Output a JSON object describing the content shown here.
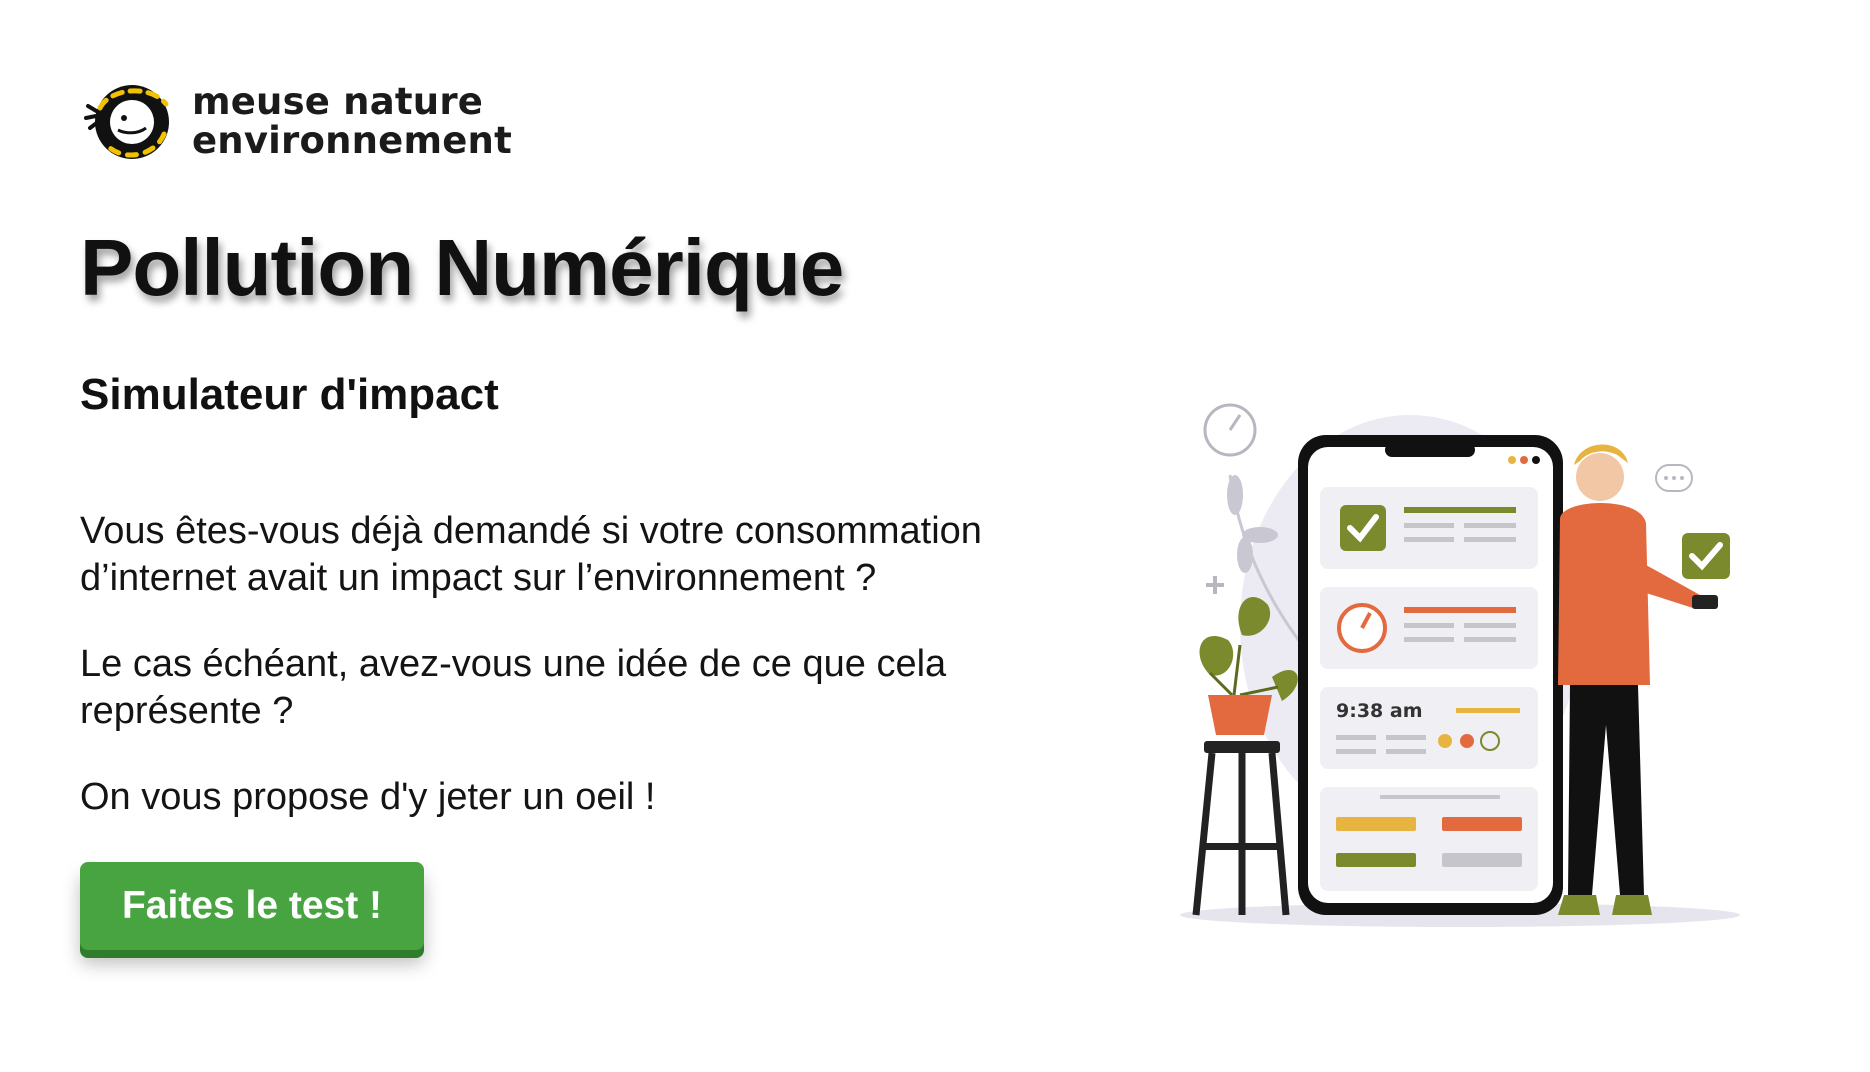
{
  "brand": {
    "line1": "meuse nature",
    "line2": "environnement",
    "logo_icon": "salamander-logo-icon"
  },
  "hero": {
    "title": "Pollution Numérique",
    "subtitle": "Simulateur d'impact",
    "paragraphs": [
      "Vous êtes-vous déjà demandé si votre consommation d’internet avait un impact sur l’environnement ?",
      "Le cas échéant, avez-vous une idée de ce que cela représente ?",
      "On vous propose d'y jeter un oeil !"
    ],
    "cta_label": "Faites le test !"
  },
  "illustration": {
    "phone_time": "9:38 am",
    "icons": [
      "phone-illustration",
      "person-illustration",
      "plant-illustration",
      "check-icon",
      "gauge-icon",
      "chat-bubble-icon"
    ]
  },
  "colors": {
    "cta": "#47a440",
    "accent_orange": "#e26a3e",
    "accent_olive": "#7b8a2c",
    "accent_yellow": "#e8b440"
  }
}
